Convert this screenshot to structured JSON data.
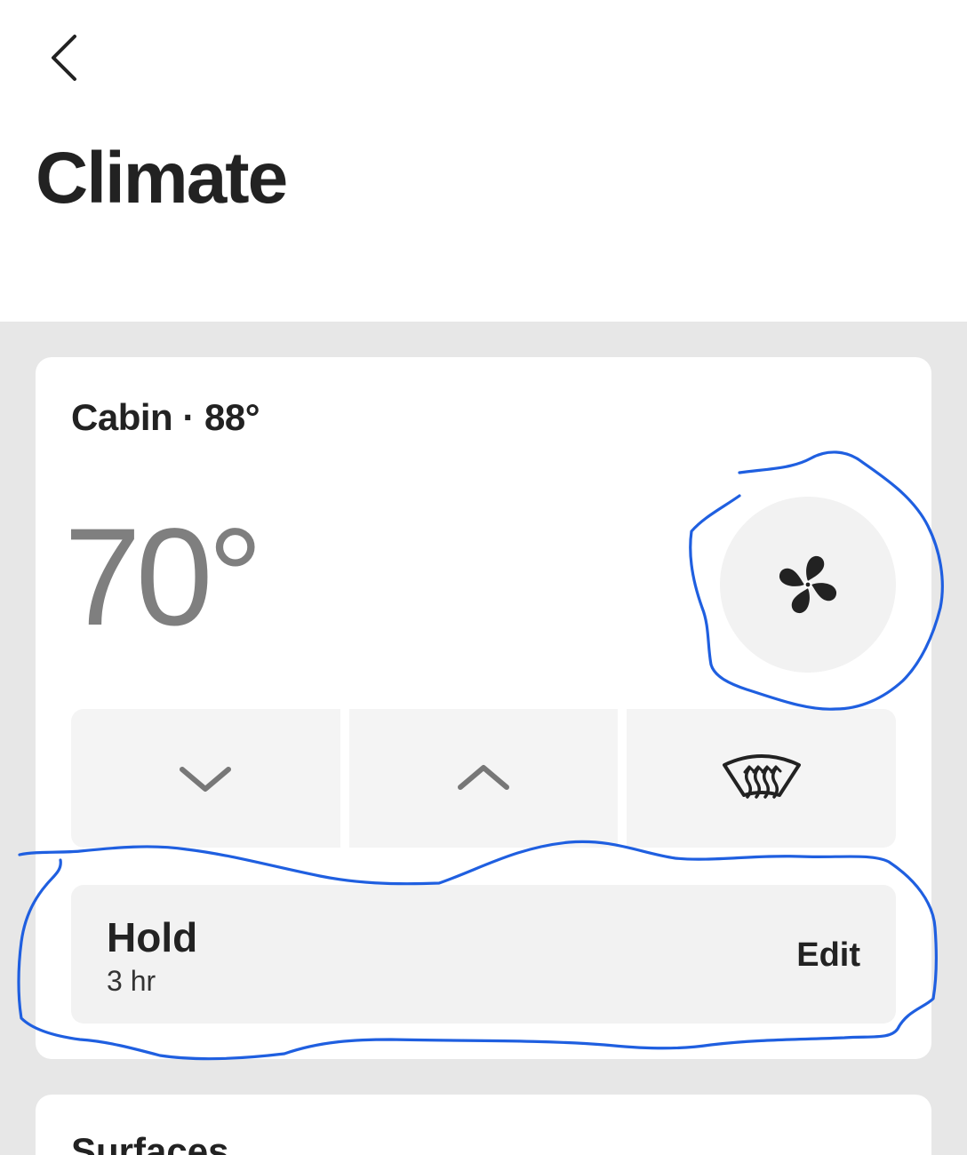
{
  "header": {
    "back_icon": "chevron-left-icon",
    "title": "Climate"
  },
  "cabin_card": {
    "label": "Cabin · 88°",
    "set_temperature": "70°",
    "fan_icon": "fan-icon",
    "controls": [
      {
        "name": "decrease",
        "icon": "chevron-down-icon"
      },
      {
        "name": "increase",
        "icon": "chevron-up-icon"
      },
      {
        "name": "defrost",
        "icon": "windshield-defrost-icon"
      }
    ],
    "hold": {
      "label": "Hold",
      "duration": "3 hr",
      "edit_label": "Edit"
    }
  },
  "surfaces_card": {
    "label": "Surfaces"
  },
  "colors": {
    "background": "#e7e7e7",
    "card": "#ffffff",
    "button_fill": "#f2f2f2",
    "text_primary": "#222222",
    "temperature_text": "#7f7f7f",
    "annotation_stroke": "#1f5fe0"
  }
}
